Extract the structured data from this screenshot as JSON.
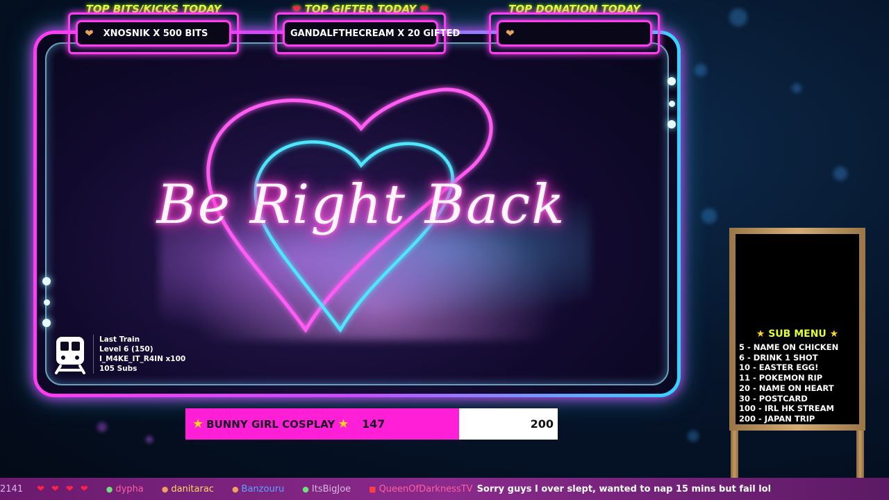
{
  "top_boxes": [
    {
      "label": "TOP BITS/KICKS TODAY",
      "value": "XNOSNIK X 500 BITS",
      "icon": "heart-icon"
    },
    {
      "label": "TOP GIFTER TODAY",
      "value": "GANDALFTHECREAM X 20 GIFTED",
      "icon": "heart-icon"
    },
    {
      "label": "TOP DONATION TODAY",
      "value": "",
      "icon": "heart-icon"
    }
  ],
  "brb_title": "Be Right Back",
  "last_train": {
    "title": "Last Train",
    "level": "Level 6  (150)",
    "user": "I_M4KE_IT_R4IN x100",
    "subs": "105 Subs"
  },
  "goal": {
    "label": "BUNNY GIRL COSPLAY",
    "current": 147,
    "target": 200,
    "fill_color": "#ff1fd6"
  },
  "sub_menu": {
    "title": "SUB MENU",
    "items": [
      "5 - NAME ON CHICKEN",
      "6 - DRINK 1 SHOT",
      "10 - EASTER EGG!",
      "11 - POKEMON RIP",
      "20 - NAME ON HEART",
      "30 - POSTCARD",
      "100 - IRL HK STREAM",
      "200 - JAPAN TRIP"
    ]
  },
  "ticker": {
    "lead": "2141",
    "users": [
      "dypha",
      "danitarac",
      "Banzouru",
      "ItsBigJoe",
      "QueenOfDarknessTV"
    ],
    "message": "Sorry guys I over slept, wanted to nap 15 mins but fail lol"
  },
  "colors": {
    "neon_pink": "#ff3cf0",
    "neon_cyan": "#34d4ff",
    "label_yellow": "#e8ff3a"
  }
}
